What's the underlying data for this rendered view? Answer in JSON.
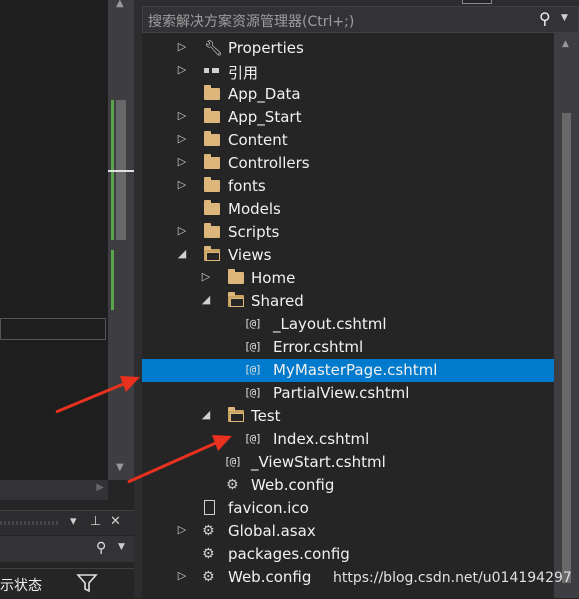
{
  "search": {
    "placeholder": "搜索解决方案资源管理器(Ctrl+;)"
  },
  "tree": [
    {
      "label": "Properties",
      "icon": "wrench-icon",
      "expander": "collapsed"
    },
    {
      "label": "引用",
      "icon": "references-icon",
      "expander": "collapsed"
    },
    {
      "label": "App_Data",
      "icon": "folder-icon",
      "expander": "none"
    },
    {
      "label": "App_Start",
      "icon": "folder-icon",
      "expander": "collapsed"
    },
    {
      "label": "Content",
      "icon": "folder-icon",
      "expander": "collapsed"
    },
    {
      "label": "Controllers",
      "icon": "folder-icon",
      "expander": "collapsed"
    },
    {
      "label": "fonts",
      "icon": "folder-icon",
      "expander": "collapsed"
    },
    {
      "label": "Models",
      "icon": "folder-icon",
      "expander": "none"
    },
    {
      "label": "Scripts",
      "icon": "folder-icon",
      "expander": "collapsed"
    },
    {
      "label": "Views",
      "icon": "folder-open-icon",
      "expander": "expanded"
    },
    {
      "label": "Home",
      "icon": "folder-icon",
      "expander": "collapsed"
    },
    {
      "label": "Shared",
      "icon": "folder-open-icon",
      "expander": "expanded"
    },
    {
      "label": "_Layout.cshtml",
      "icon": "cshtml-icon",
      "expander": "none"
    },
    {
      "label": "Error.cshtml",
      "icon": "cshtml-icon",
      "expander": "none"
    },
    {
      "label": "MyMasterPage.cshtml",
      "icon": "cshtml-icon",
      "expander": "none",
      "selected": true
    },
    {
      "label": "PartialView.cshtml",
      "icon": "cshtml-icon",
      "expander": "none"
    },
    {
      "label": "Test",
      "icon": "folder-open-icon",
      "expander": "expanded"
    },
    {
      "label": "Index.cshtml",
      "icon": "cshtml-icon",
      "expander": "none"
    },
    {
      "label": "_ViewStart.cshtml",
      "icon": "cshtml-icon",
      "expander": "none"
    },
    {
      "label": "Web.config",
      "icon": "config-icon",
      "expander": "none"
    },
    {
      "label": "favicon.ico",
      "icon": "file-icon",
      "expander": "none"
    },
    {
      "label": "Global.asax",
      "icon": "config-icon",
      "expander": "collapsed"
    },
    {
      "label": "packages.config",
      "icon": "config-icon",
      "expander": "none"
    },
    {
      "label": "Web.config",
      "icon": "config-icon",
      "expander": "collapsed"
    }
  ],
  "cshtml_glyph": "[@]",
  "bottom_panel": {
    "status_text": "示状态"
  },
  "watermark": "https://blog.csdn.net/u014194297",
  "colors": {
    "selection": "#007acc",
    "folder": "#dcb67a",
    "arrow": "#e8311f"
  }
}
